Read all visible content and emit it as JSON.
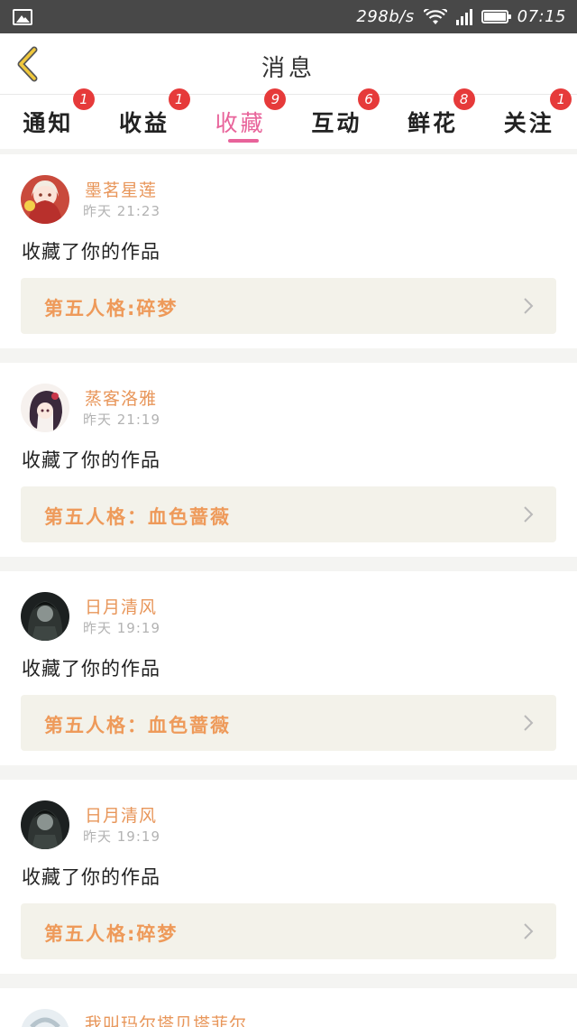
{
  "status_bar": {
    "speed": "298b/s",
    "time": "07:15"
  },
  "header": {
    "title": "消息"
  },
  "tabs": [
    {
      "label": "通知",
      "badge": "1"
    },
    {
      "label": "收益",
      "badge": "1"
    },
    {
      "label": "收藏",
      "badge": "9",
      "active": true
    },
    {
      "label": "互动",
      "badge": "6"
    },
    {
      "label": "鲜花",
      "badge": "8"
    },
    {
      "label": "关注",
      "badge": "1"
    }
  ],
  "colors": {
    "accent_pink": "#e8639a",
    "badge_red": "#e63a3a",
    "name_orange": "#e8965a",
    "work_orange": "#ee9a5a",
    "work_box_bg": "#f3f2ea"
  },
  "feed": [
    {
      "user": "墨茗星莲",
      "time": "昨天 21:23",
      "action": "收藏了你的作品",
      "work": "第五人格:碎梦"
    },
    {
      "user": "蒸客洛雅",
      "time": "昨天 21:19",
      "action": "收藏了你的作品",
      "work": "第五人格：血色蔷薇"
    },
    {
      "user": "日月清风",
      "time": "昨天 19:19",
      "action": "收藏了你的作品",
      "work": "第五人格：血色蔷薇"
    },
    {
      "user": "日月清风",
      "time": "昨天 19:19",
      "action": "收藏了你的作品",
      "work": "第五人格:碎梦"
    }
  ],
  "partial_item": {
    "user": "我叫玛尔塔贝塔菲尔"
  }
}
